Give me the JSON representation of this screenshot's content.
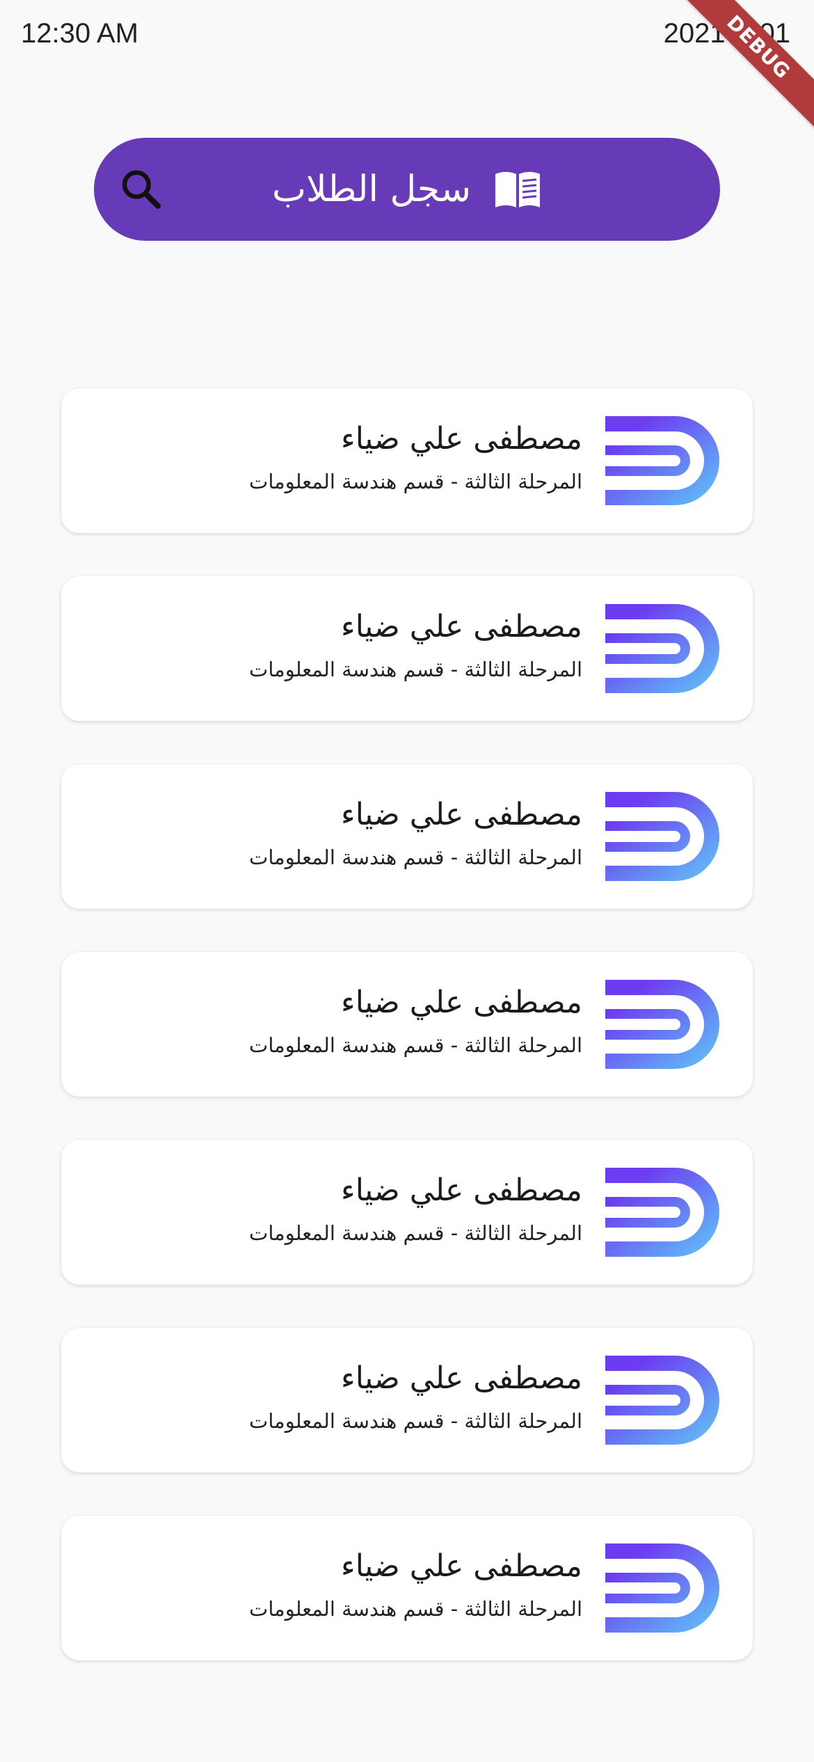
{
  "status_bar": {
    "time": "12:30 AM",
    "date": "2021-3-01"
  },
  "debug_banner": "DEBUG",
  "header": {
    "title": "سجل الطلاب",
    "background": "#673ab7",
    "search_icon": "search-icon",
    "book_icon": "open-book-icon"
  },
  "students": [
    {
      "name": "مصطفى علي ضياء",
      "info": "المرحلة الثالثة - قسم هندسة المعلومات"
    },
    {
      "name": "مصطفى علي ضياء",
      "info": "المرحلة الثالثة - قسم هندسة المعلومات"
    },
    {
      "name": "مصطفى علي ضياء",
      "info": "المرحلة الثالثة - قسم هندسة المعلومات"
    },
    {
      "name": "مصطفى علي ضياء",
      "info": "المرحلة الثالثة - قسم هندسة المعلومات"
    },
    {
      "name": "مصطفى علي ضياء",
      "info": "المرحلة الثالثة - قسم هندسة المعلومات"
    },
    {
      "name": "مصطفى علي ضياء",
      "info": "المرحلة الثالثة - قسم هندسة المعلومات"
    },
    {
      "name": "مصطفى علي ضياء",
      "info": "المرحلة الثالثة - قسم هندسة المعلومات"
    }
  ],
  "logo_gradient": [
    "#6d3cf0",
    "#5fc9f8"
  ]
}
